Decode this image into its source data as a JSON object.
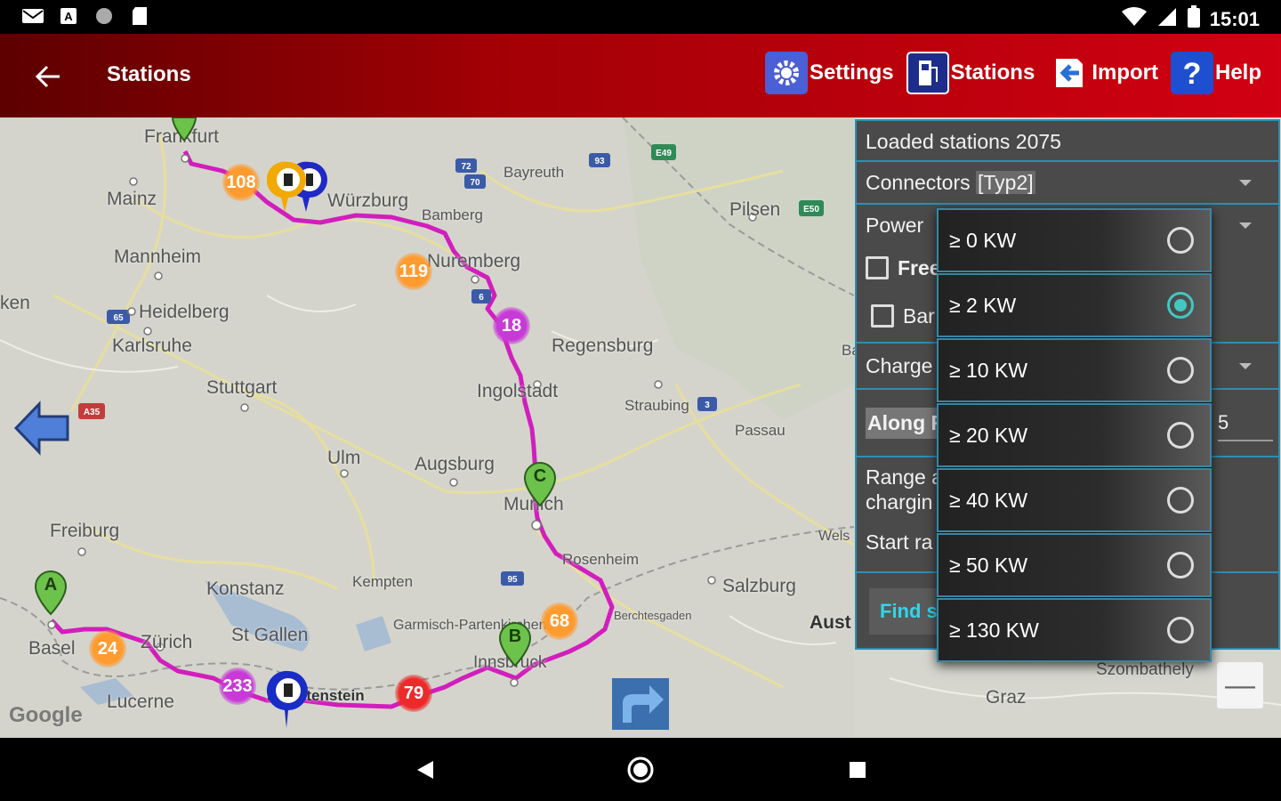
{
  "status_bar": {
    "time": "15:01",
    "left_icons": [
      "mail-icon",
      "a-icon",
      "circle-icon",
      "sd-card-icon"
    ],
    "right_icons": [
      "wifi-icon",
      "signal-icon",
      "battery-icon"
    ]
  },
  "app_bar": {
    "title": "Stations",
    "actions": [
      {
        "label": "Settings",
        "icon": "gear-icon"
      },
      {
        "label": "Stations",
        "icon": "charging-station-icon"
      },
      {
        "label": "Import",
        "icon": "import-icon"
      },
      {
        "label": "Help",
        "icon": "help-icon"
      }
    ]
  },
  "map": {
    "labels": [
      "Frankfurt",
      "Mainz",
      "Mannheim",
      "Heidelberg",
      "Karlsruhe",
      "Stuttgart",
      "Ulm",
      "Augsburg",
      "Freiburg",
      "Basel",
      "Zürich",
      "Lucerne",
      "Konstanz",
      "St Gallen",
      "Kempten",
      "Bamberg",
      "Bayreuth",
      "Nuremberg",
      "Regensburg",
      "Ingolstadt",
      "Straubing",
      "Passau",
      "Munich",
      "Rosenheim",
      "Salzburg",
      "Innsbruck",
      "Pilsen",
      "Würzburg",
      "Graz",
      "Szombathely",
      "Aust",
      "Garmisch-Partenkirchen",
      "Berchtesgaden",
      "Wels",
      "Liechtenstein",
      "ken",
      "Bay"
    ],
    "clusters": [
      {
        "count": "108",
        "color": "orange"
      },
      {
        "count": "119",
        "color": "orange"
      },
      {
        "count": "18",
        "color": "purple"
      },
      {
        "count": "24",
        "color": "orange"
      },
      {
        "count": "233",
        "color": "purple"
      },
      {
        "count": "79",
        "color": "red"
      },
      {
        "count": "68",
        "color": "orange"
      }
    ],
    "waypoints": [
      "A",
      "B",
      "C"
    ],
    "highway_badges": [
      "A35",
      "E49",
      "E50",
      "72",
      "70",
      "93",
      "6",
      "65",
      "3",
      "95"
    ],
    "attribution": "Google",
    "route_color": "#d21ebd"
  },
  "panel": {
    "loaded_label": "Loaded  stations  2075",
    "connectors_label": "Connectors",
    "connectors_value": "[Typ2]",
    "power_label": "Power",
    "free_label": "Free",
    "bar_label": "Bar",
    "charge_label": "Charge",
    "along_label": "Along R",
    "along_value": "5",
    "range_label_1": "Range a",
    "range_label_2": "chargin",
    "start_label": "Start ra",
    "find_label": "Find s"
  },
  "power_options": [
    {
      "label": "≥ 0 KW",
      "selected": false
    },
    {
      "label": "≥ 2 KW",
      "selected": true
    },
    {
      "label": "≥ 10 KW",
      "selected": false
    },
    {
      "label": "≥ 20 KW",
      "selected": false
    },
    {
      "label": "≥ 40 KW",
      "selected": false
    },
    {
      "label": "≥ 50 KW",
      "selected": false
    },
    {
      "label": "≥ 130 KW",
      "selected": false
    }
  ],
  "colors": {
    "accent": "#43c7c1",
    "appbar": "#c0000e",
    "panel_border": "#2c8fb3"
  }
}
